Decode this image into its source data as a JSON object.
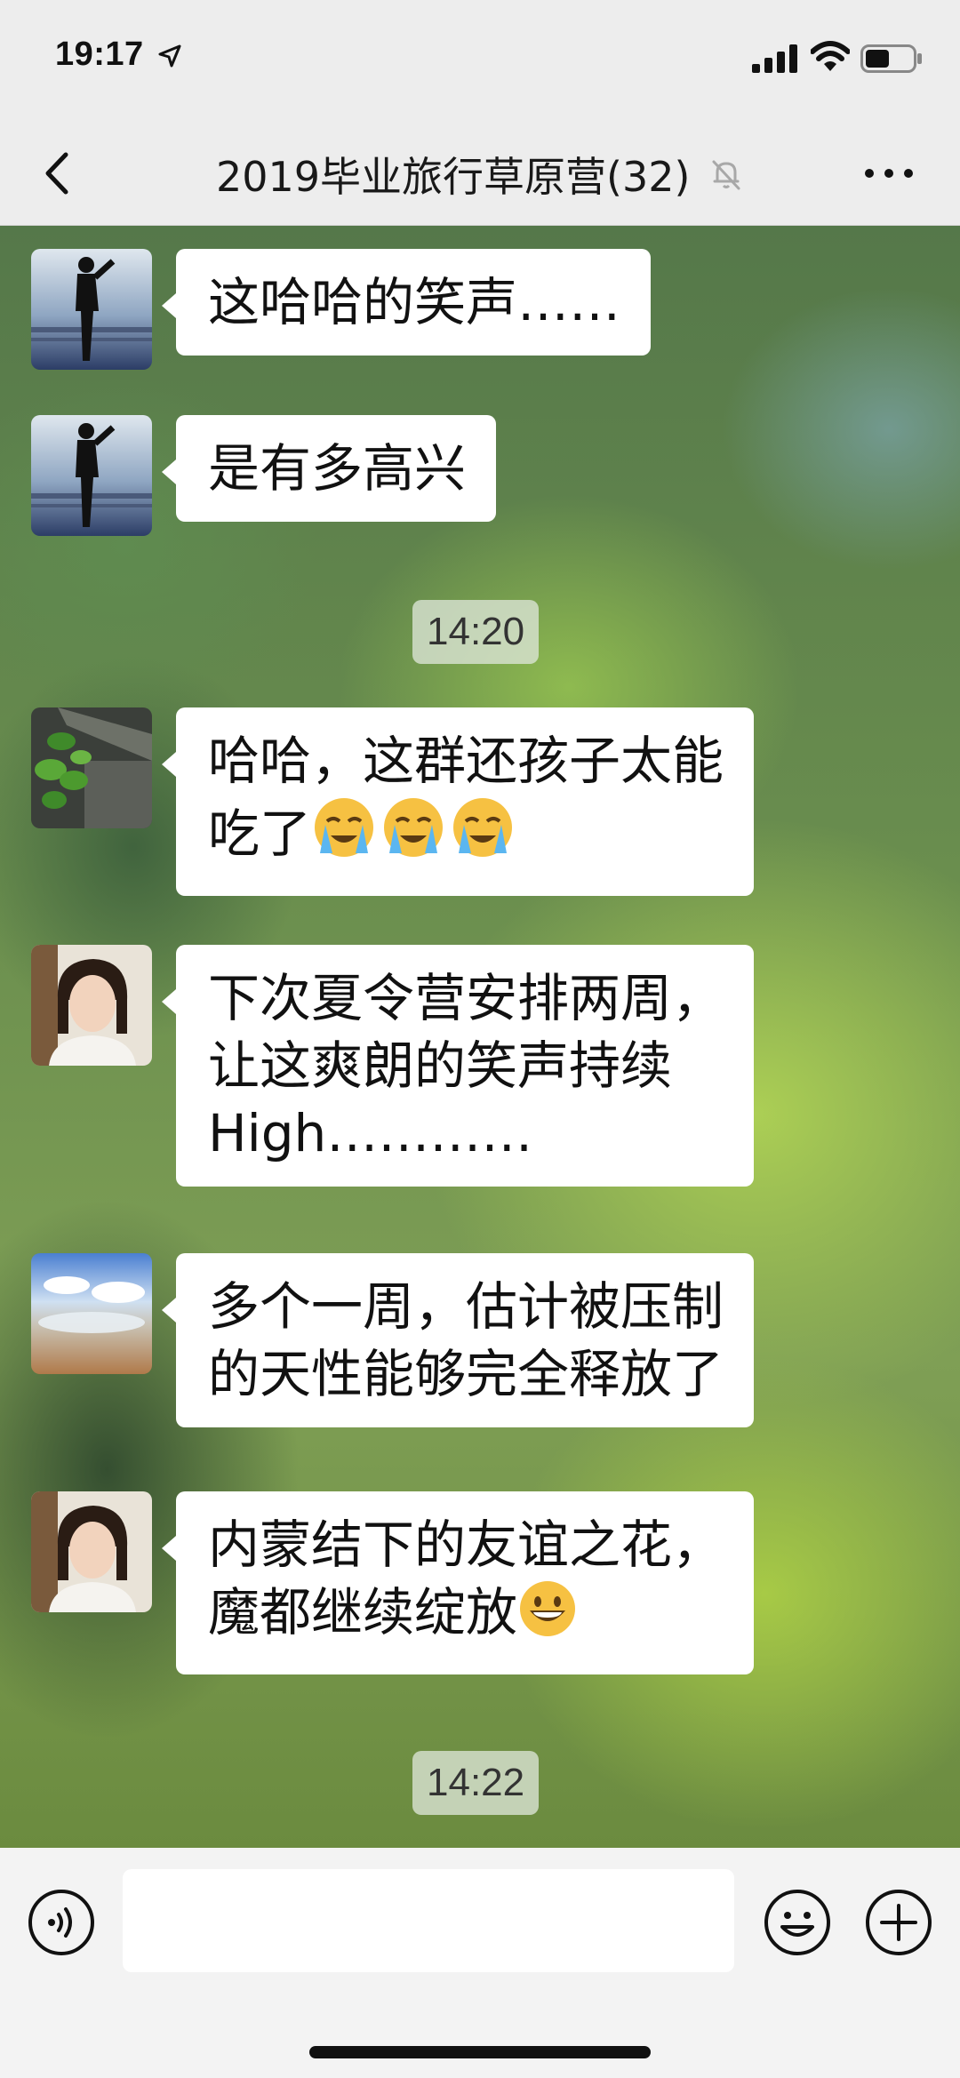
{
  "status_bar": {
    "time": "19:17",
    "battery_level": 0.5
  },
  "header": {
    "title": "2019毕业旅行草原营(32)",
    "muted": true
  },
  "messages": [
    {
      "type": "message",
      "text": "这哈哈的笑声……",
      "avatar": "avatar-man-silhouette"
    },
    {
      "type": "message",
      "text": "是有多高兴",
      "avatar": "avatar-man-silhouette"
    },
    {
      "type": "time",
      "text": "14:20"
    },
    {
      "type": "message",
      "line1": "哈哈，这群还孩子太能",
      "line2": "吃了",
      "emoji_count": 3,
      "emoji": "loudly-crying-face-icon",
      "avatar": "avatar-plant"
    },
    {
      "type": "message",
      "line1": "下次夏令营安排两周，",
      "line2": "让这爽朗的笑声持续",
      "line3": "High…………",
      "avatar": "avatar-woman"
    },
    {
      "type": "message",
      "line1": "多个一周，估计被压制",
      "line2": "的天性能够完全释放了",
      "avatar": "avatar-landscape"
    },
    {
      "type": "message",
      "line1": "内蒙结下的友谊之花，",
      "line2": "魔都继续绽放",
      "emoji": "grinning-face-icon",
      "avatar": "avatar-woman"
    },
    {
      "type": "time",
      "text": "14:22"
    }
  ],
  "input_bar": {
    "value": "",
    "placeholder": ""
  },
  "colors": {
    "bubble": "#ffffff",
    "nav_bg": "#ededed",
    "input_bg": "#f3f3f3"
  }
}
